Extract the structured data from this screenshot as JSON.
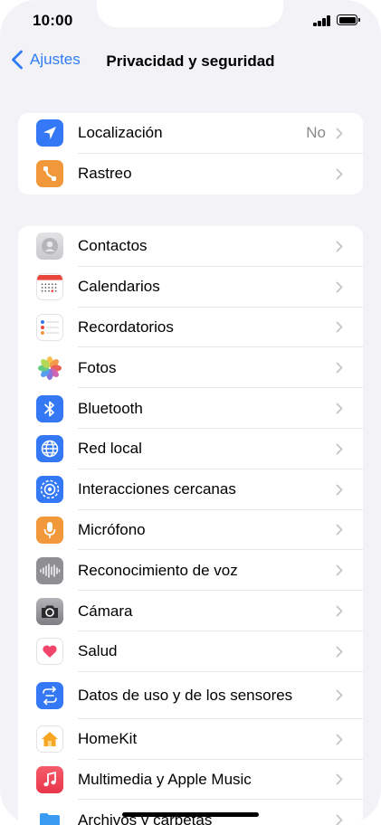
{
  "status": {
    "time": "10:00"
  },
  "nav": {
    "back_label": "Ajustes",
    "title": "Privacidad y seguridad"
  },
  "group1": [
    {
      "label": "Localización",
      "value": "No",
      "icon": "location-arrow-icon",
      "color": "#3478f6"
    },
    {
      "label": "Rastreo",
      "value": "",
      "icon": "tracking-icon",
      "color": "#f1993a"
    }
  ],
  "group2": [
    {
      "label": "Contactos",
      "icon": "contacts-icon",
      "color": "#cfcfd3"
    },
    {
      "label": "Calendarios",
      "icon": "calendar-icon",
      "color": "#ffffff"
    },
    {
      "label": "Recordatorios",
      "icon": "reminders-icon",
      "color": "#ffffff"
    },
    {
      "label": "Fotos",
      "icon": "photos-icon",
      "color": "#ffffff"
    },
    {
      "label": "Bluetooth",
      "icon": "bluetooth-icon",
      "color": "#3478f6"
    },
    {
      "label": "Red local",
      "icon": "globe-icon",
      "color": "#3478f6"
    },
    {
      "label": "Interacciones cercanas",
      "icon": "nearby-interactions-icon",
      "color": "#3478f6"
    },
    {
      "label": "Micrófono",
      "icon": "microphone-icon",
      "color": "#f1993a"
    },
    {
      "label": "Reconocimiento de voz",
      "icon": "waveform-icon",
      "color": "#8e8e93"
    },
    {
      "label": "Cámara",
      "icon": "camera-icon",
      "color": "#8e8e93"
    },
    {
      "label": "Salud",
      "icon": "heart-icon",
      "color": "#ffffff"
    },
    {
      "label": "Datos de uso y de los sensores",
      "icon": "sensor-data-icon",
      "color": "#3478f6"
    },
    {
      "label": "HomeKit",
      "icon": "home-icon",
      "color": "#ffffff"
    },
    {
      "label": "Multimedia y Apple Music",
      "icon": "music-note-icon",
      "color": "#f0464f"
    },
    {
      "label": "Archivos y carpetas",
      "icon": "folder-icon",
      "color": "#3a9bf3"
    }
  ]
}
